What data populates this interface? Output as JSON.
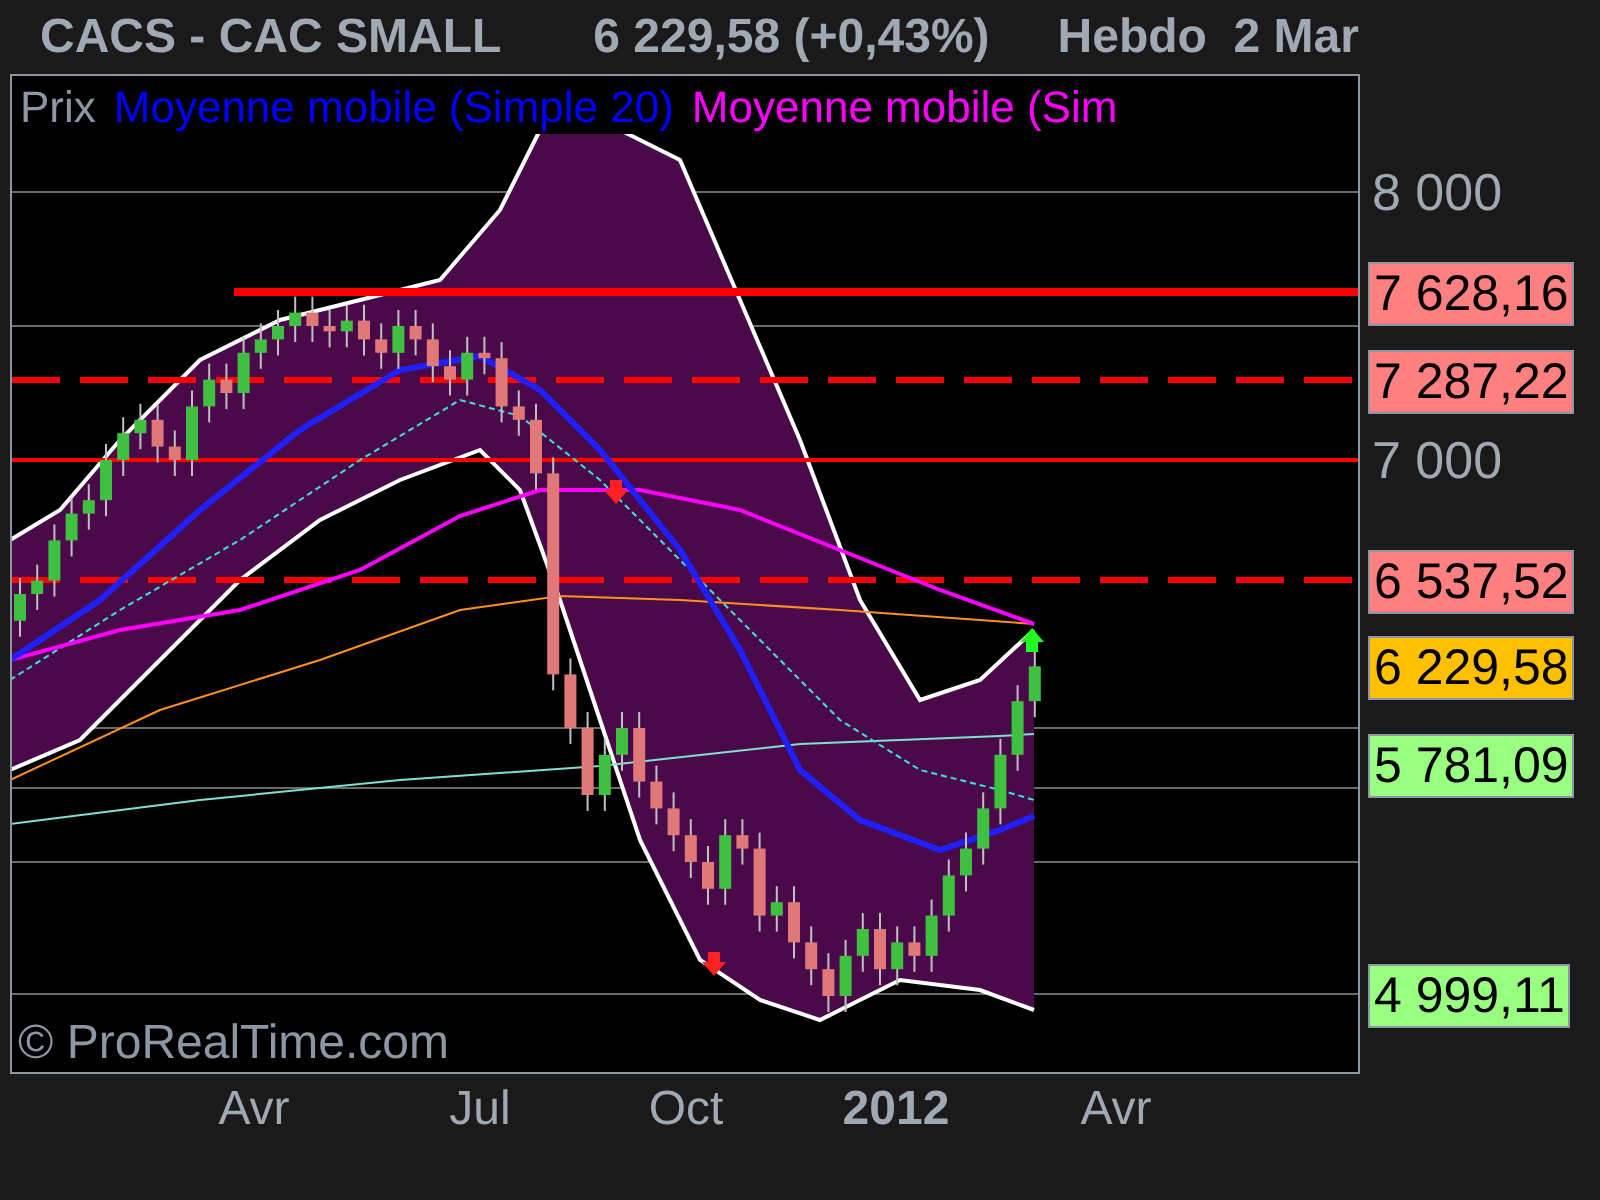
{
  "header": {
    "symbol": "CACS - CAC SMALL",
    "quote": "6 229,58 (+0,43%)",
    "period": "Hebdo  2 Mar"
  },
  "legend": [
    {
      "label": "Prix",
      "color": "#8c96a4"
    },
    {
      "label": "Moyenne mobile (Simple 20)",
      "color": "#0000ff"
    },
    {
      "label": "Moyenne mobile (Sim",
      "color": "#ff00ff"
    }
  ],
  "watermark": "© ProRealTime.com",
  "price_axis": [
    {
      "kind": "tick",
      "text": "8 000"
    },
    {
      "kind": "tag",
      "text": "7 628,16",
      "color": "#ff8080"
    },
    {
      "kind": "tag",
      "text": "7 287,22",
      "color": "#ff8080"
    },
    {
      "kind": "tick",
      "text": "7 000"
    },
    {
      "kind": "tag",
      "text": "6 537,52",
      "color": "#ff8080"
    },
    {
      "kind": "tag",
      "text": "6 229,58",
      "color": "#ffc000"
    },
    {
      "kind": "tag",
      "text": "5 781,09",
      "color": "#99ff80"
    },
    {
      "kind": "tag",
      "text": "4 999,11",
      "color": "#99ff80"
    }
  ],
  "time_axis": [
    {
      "text": "Avr",
      "bold": false
    },
    {
      "text": "Jul",
      "bold": false
    },
    {
      "text": "Oct",
      "bold": false
    },
    {
      "text": "2012",
      "bold": true
    },
    {
      "text": "Avr",
      "bold": false
    }
  ]
}
